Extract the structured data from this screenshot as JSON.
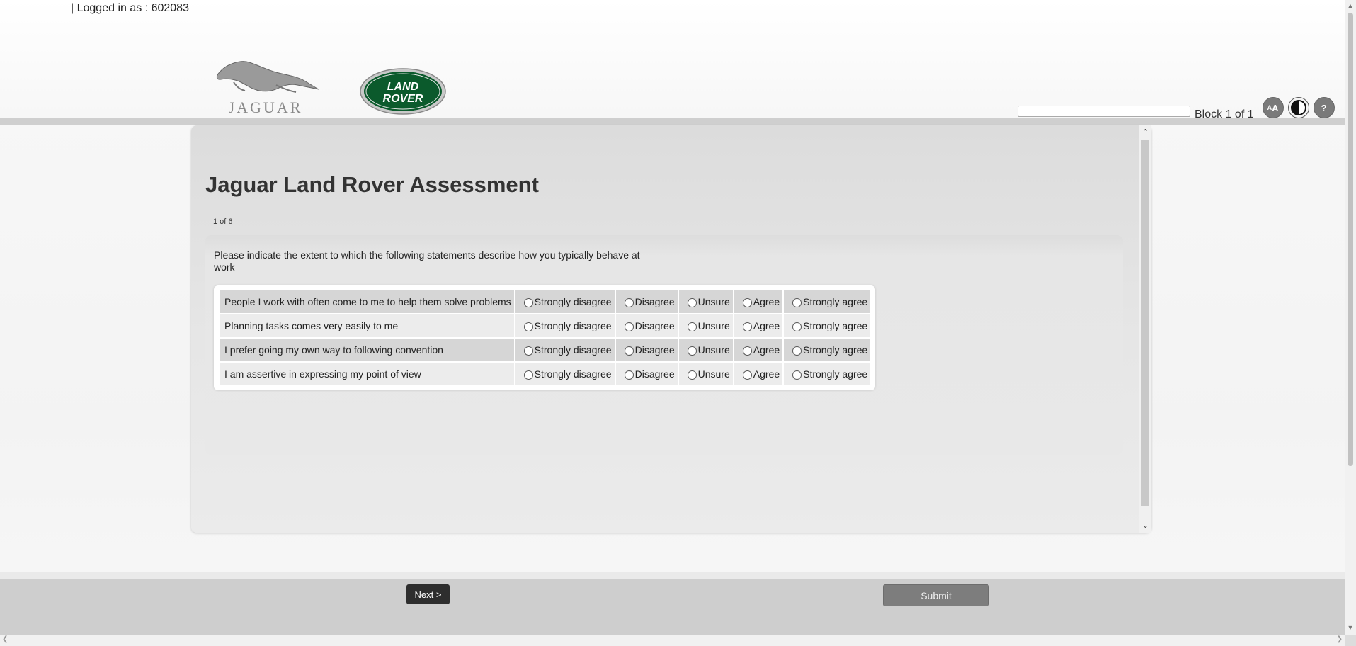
{
  "topbar": {
    "separator": "|",
    "logged_in_text": "Logged in as : 602083"
  },
  "logos": {
    "jaguar_text": "JAGUAR",
    "landrover_line1": "LAND",
    "landrover_line2": "ROVER"
  },
  "tools": {
    "search_value": "",
    "block_label": "Block 1 of 1",
    "text_size_icon": "text-size-icon",
    "contrast_icon": "contrast-icon",
    "help_label": "?"
  },
  "assessment": {
    "title": "Jaguar Land Rover Assessment",
    "progress": "1  of 6",
    "instructions": "Please indicate the extent to which the following statements describe how you typically behave at work",
    "options": [
      "Strongly disagree",
      "Disagree",
      "Unsure",
      "Agree",
      "Strongly agree"
    ],
    "statements": [
      "People I work with often come to me to help them solve problems",
      "Planning tasks comes very easily to me",
      "I prefer going my own way to following convention",
      "I am assertive in expressing my point of view"
    ]
  },
  "footer": {
    "next_label": "Next >",
    "submit_label": "Submit"
  },
  "colors": {
    "panel_bg": "#e3e3e3",
    "footer_bg": "#cecece",
    "jlr_green": "#0b5a2c"
  }
}
